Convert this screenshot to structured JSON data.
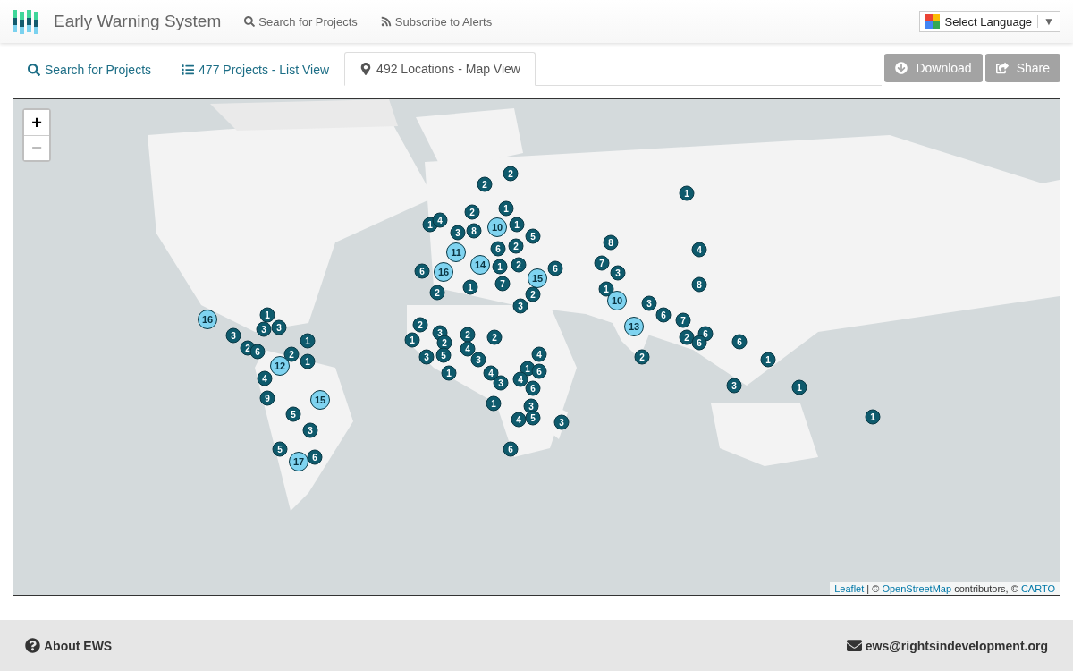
{
  "header": {
    "title": "Early Warning System",
    "nav": [
      {
        "label": "Search for Projects"
      },
      {
        "label": "Subscribe to Alerts"
      }
    ],
    "language": {
      "label": "Select Language",
      "caret": "▼"
    }
  },
  "tabs": [
    {
      "label": "Search for Projects",
      "selected": false
    },
    {
      "label": "477 Projects - List View",
      "selected": false
    },
    {
      "label": "492 Locations - Map View",
      "selected": true
    }
  ],
  "actions": [
    {
      "label": "Download"
    },
    {
      "label": "Share"
    }
  ],
  "map": {
    "zoom_in": {
      "label": "+",
      "disabled": false
    },
    "zoom_out": {
      "label": "−",
      "disabled": true
    },
    "markers": [
      {
        "count": "1",
        "kind": "small"
      },
      {
        "count": "2",
        "kind": "small"
      },
      {
        "count": "2",
        "kind": "small"
      },
      {
        "count": "2",
        "kind": "small"
      },
      {
        "count": "1",
        "kind": "small"
      },
      {
        "count": "1",
        "kind": "small"
      },
      {
        "count": "4",
        "kind": "small"
      },
      {
        "count": "3",
        "kind": "small"
      },
      {
        "count": "8",
        "kind": "small"
      },
      {
        "count": "10",
        "kind": "large"
      },
      {
        "count": "1",
        "kind": "small"
      },
      {
        "count": "5",
        "kind": "small"
      },
      {
        "count": "6",
        "kind": "small"
      },
      {
        "count": "2",
        "kind": "small"
      },
      {
        "count": "11",
        "kind": "large"
      },
      {
        "count": "14",
        "kind": "large"
      },
      {
        "count": "1",
        "kind": "small"
      },
      {
        "count": "2",
        "kind": "small"
      },
      {
        "count": "7",
        "kind": "small"
      },
      {
        "count": "6",
        "kind": "small"
      },
      {
        "count": "16",
        "kind": "large"
      },
      {
        "count": "15",
        "kind": "large"
      },
      {
        "count": "6",
        "kind": "small"
      },
      {
        "count": "2",
        "kind": "small"
      },
      {
        "count": "1",
        "kind": "small"
      },
      {
        "count": "2",
        "kind": "small"
      },
      {
        "count": "3",
        "kind": "small"
      },
      {
        "count": "2",
        "kind": "small"
      },
      {
        "count": "3",
        "kind": "small"
      },
      {
        "count": "1",
        "kind": "small"
      },
      {
        "count": "2",
        "kind": "small"
      },
      {
        "count": "3",
        "kind": "small"
      },
      {
        "count": "5",
        "kind": "small"
      },
      {
        "count": "2",
        "kind": "small"
      },
      {
        "count": "2",
        "kind": "small"
      },
      {
        "count": "4",
        "kind": "small"
      },
      {
        "count": "3",
        "kind": "small"
      },
      {
        "count": "1",
        "kind": "small"
      },
      {
        "count": "4",
        "kind": "small"
      },
      {
        "count": "3",
        "kind": "small"
      },
      {
        "count": "4",
        "kind": "small"
      },
      {
        "count": "1",
        "kind": "small"
      },
      {
        "count": "6",
        "kind": "small"
      },
      {
        "count": "4",
        "kind": "small"
      },
      {
        "count": "6",
        "kind": "small"
      },
      {
        "count": "1",
        "kind": "small"
      },
      {
        "count": "3",
        "kind": "small"
      },
      {
        "count": "4",
        "kind": "small"
      },
      {
        "count": "5",
        "kind": "small"
      },
      {
        "count": "3",
        "kind": "small"
      },
      {
        "count": "6",
        "kind": "small"
      },
      {
        "count": "8",
        "kind": "small"
      },
      {
        "count": "4",
        "kind": "small"
      },
      {
        "count": "7",
        "kind": "small"
      },
      {
        "count": "3",
        "kind": "small"
      },
      {
        "count": "8",
        "kind": "small"
      },
      {
        "count": "1",
        "kind": "small"
      },
      {
        "count": "10",
        "kind": "large"
      },
      {
        "count": "3",
        "kind": "small"
      },
      {
        "count": "6",
        "kind": "small"
      },
      {
        "count": "7",
        "kind": "small"
      },
      {
        "count": "13",
        "kind": "large"
      },
      {
        "count": "2",
        "kind": "small"
      },
      {
        "count": "6",
        "kind": "small"
      },
      {
        "count": "6",
        "kind": "small"
      },
      {
        "count": "6",
        "kind": "small"
      },
      {
        "count": "2",
        "kind": "small"
      },
      {
        "count": "1",
        "kind": "small"
      },
      {
        "count": "3",
        "kind": "small"
      },
      {
        "count": "1",
        "kind": "small"
      },
      {
        "count": "1",
        "kind": "small"
      },
      {
        "count": "16",
        "kind": "large"
      },
      {
        "count": "1",
        "kind": "small"
      },
      {
        "count": "3",
        "kind": "small"
      },
      {
        "count": "3",
        "kind": "small"
      },
      {
        "count": "3",
        "kind": "small"
      },
      {
        "count": "2",
        "kind": "small"
      },
      {
        "count": "6",
        "kind": "small"
      },
      {
        "count": "1",
        "kind": "small"
      },
      {
        "count": "2",
        "kind": "small"
      },
      {
        "count": "12",
        "kind": "large"
      },
      {
        "count": "1",
        "kind": "small"
      },
      {
        "count": "4",
        "kind": "small"
      },
      {
        "count": "9",
        "kind": "small"
      },
      {
        "count": "15",
        "kind": "large"
      },
      {
        "count": "5",
        "kind": "small"
      },
      {
        "count": "3",
        "kind": "small"
      },
      {
        "count": "5",
        "kind": "small"
      },
      {
        "count": "17",
        "kind": "large"
      },
      {
        "count": "6",
        "kind": "small"
      }
    ],
    "attribution": {
      "leaflet": "Leaflet",
      "separator": " | © ",
      "osm": "OpenStreetMap",
      "middle": " contributors, © ",
      "carto": "CARTO"
    }
  },
  "footer": {
    "about": "About EWS",
    "email": "ews@rightsindevelopment.org"
  }
}
